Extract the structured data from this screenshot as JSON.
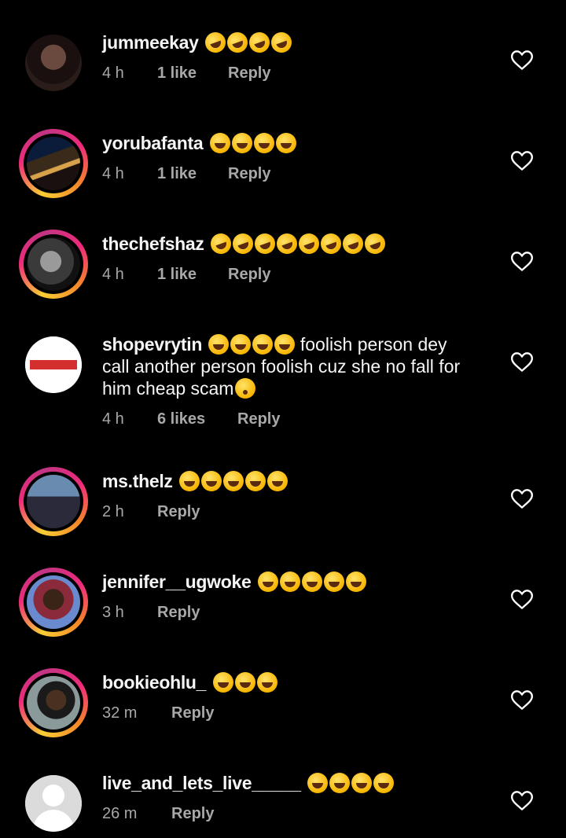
{
  "comments": [
    {
      "username": "jummeekay",
      "emoji_kind": "rofl",
      "emoji_count": 4,
      "text": "",
      "time": "4 h",
      "likes": "1 like",
      "reply": "Reply",
      "avatar": "photo"
    },
    {
      "username": "yorubafanta",
      "emoji_kind": "joy",
      "emoji_count": 4,
      "text": "",
      "time": "4 h",
      "likes": "1 like",
      "reply": "Reply",
      "avatar": "photo-ring"
    },
    {
      "username": "thechefshaz",
      "emoji_kind": "rofl",
      "emoji_count": 8,
      "text": "",
      "time": "4 h",
      "likes": "1 like",
      "reply": "Reply",
      "avatar": "photo-ring"
    },
    {
      "username": "shopevrytin",
      "emoji_kind": "joy",
      "emoji_count": 4,
      "text_line1": "foolish person dey",
      "text_line2": "call another person foolish cuz she no fall for",
      "text_line3": "him cheap scam",
      "time": "4 h",
      "likes": "6 likes",
      "reply": "Reply",
      "avatar": "logo"
    },
    {
      "username": "ms.thelz",
      "emoji_kind": "joy",
      "emoji_count": 5,
      "text": "",
      "time": "2 h",
      "likes": "",
      "reply": "Reply",
      "avatar": "photo-ring"
    },
    {
      "username": "jennifer__ugwoke",
      "emoji_kind": "joy",
      "emoji_count": 5,
      "text": "",
      "time": "3 h",
      "likes": "",
      "reply": "Reply",
      "avatar": "photo-ring"
    },
    {
      "username": "bookieohlu_",
      "emoji_kind": "joy",
      "emoji_count": 3,
      "text": "",
      "time": "32 m",
      "likes": "",
      "reply": "Reply",
      "avatar": "photo-ring"
    },
    {
      "username": "live_and_lets_live_____",
      "emoji_kind": "joy",
      "emoji_count": 4,
      "text": "",
      "time": "26 m",
      "likes": "",
      "reply": "Reply",
      "avatar": "default"
    }
  ],
  "icons": {
    "like": "heart-outline-icon"
  },
  "colors": {
    "background": "#000000",
    "text": "#f5f5f5",
    "muted": "#a8a8a8"
  }
}
